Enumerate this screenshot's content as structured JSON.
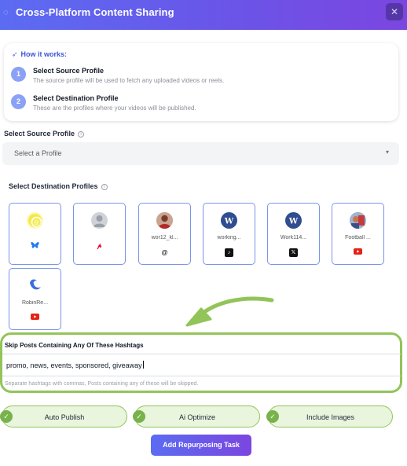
{
  "header": {
    "title": "Cross-Platform Content Sharing",
    "close_symbol": "✕"
  },
  "how_it_works": {
    "title": "How it works:",
    "steps": [
      {
        "num": "1",
        "title": "Select Source Profile",
        "desc": "The source profile will be used to fetch any uploaded videos or reels."
      },
      {
        "num": "2",
        "title": "Select Destination Profile",
        "desc": "These are the profiles where your videos will be published."
      }
    ]
  },
  "source": {
    "label": "Select Source Profile",
    "placeholder": "Select a Profile"
  },
  "destination": {
    "label": "Select Destination Profiles",
    "profiles": [
      {
        "name": "",
        "platform": "bluesky"
      },
      {
        "name": "",
        "platform": "pinterest"
      },
      {
        "name": "wor12_kl...",
        "platform": "threads"
      },
      {
        "name": "working...",
        "platform": "tiktok"
      },
      {
        "name": "Work114...",
        "platform": "x"
      },
      {
        "name": "Football ...",
        "platform": "youtube"
      },
      {
        "name": "RobinRe...",
        "platform": "youtube"
      }
    ]
  },
  "hashtags": {
    "label": "Skip Posts Containing Any Of These Hashtags",
    "value": "promo, news, events, sponsored, giveaway",
    "help": "Separate hashtags with commas, Posts containing any of these will be skipped."
  },
  "options": {
    "auto_publish": "Auto Publish",
    "ai_optimize": "Ai Optimize",
    "include_images": "Include Images"
  },
  "submit_label": "Add Repurposing Task",
  "colors": {
    "accent": "#5b6cf2",
    "highlight": "#92c45a",
    "step_badge": "#8aa1f5"
  }
}
